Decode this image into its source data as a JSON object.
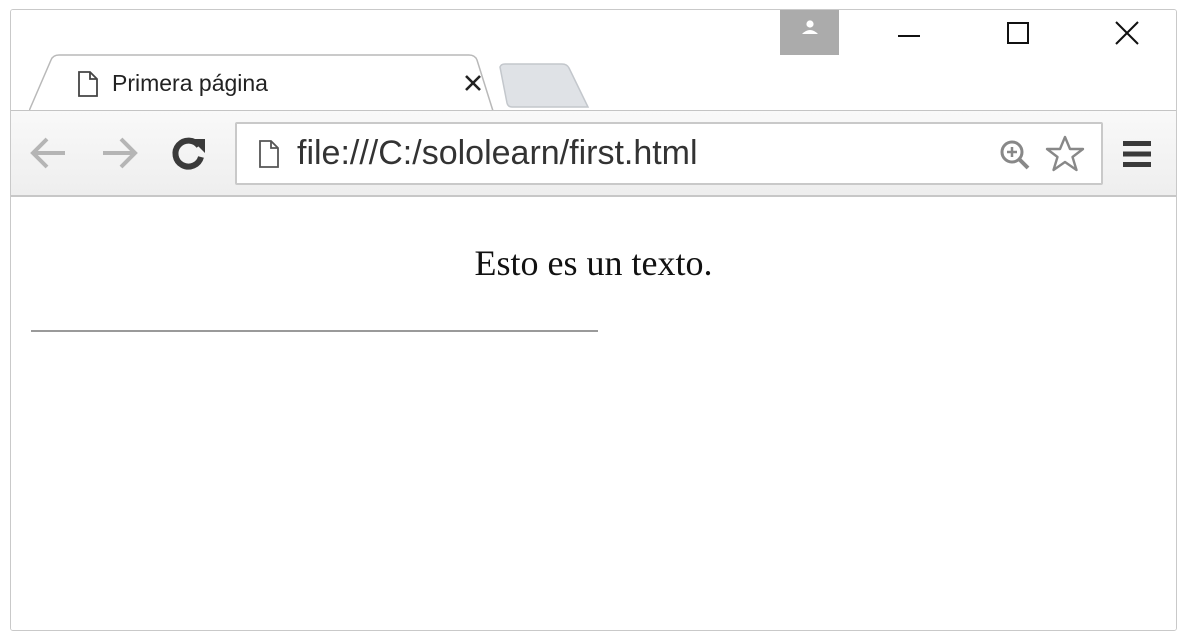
{
  "window": {
    "controls": {
      "profile_icon": "avatar-icon",
      "minimize_icon": "minimize-icon",
      "maximize_icon": "maximize-icon",
      "close_icon": "close-icon"
    }
  },
  "tabs": [
    {
      "title": "Primera página",
      "icon": "page-icon",
      "active": true
    }
  ],
  "toolbar": {
    "back_icon": "arrow-left-icon",
    "forward_icon": "arrow-right-icon",
    "reload_icon": "reload-icon",
    "url": "file:///C:/sololearn/first.html",
    "zoom_icon": "zoom-in-icon",
    "bookmark_icon": "star-icon",
    "menu_icon": "hamburger-menu-icon"
  },
  "page": {
    "paragraph": "Esto es un texto."
  },
  "colors": {
    "profile_bg": "#ababab",
    "toolbar_bg": "#f2f2f2",
    "disabled_nav": "#b5b5b5",
    "text": "#111111"
  }
}
